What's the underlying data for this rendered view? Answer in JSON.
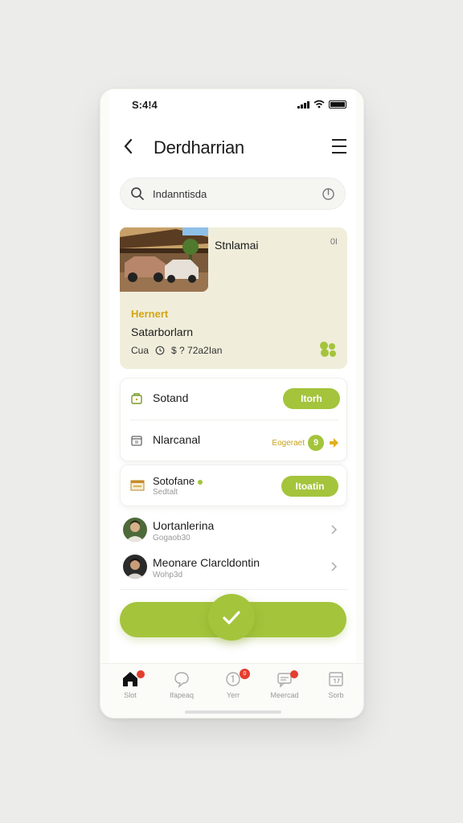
{
  "status_bar": {
    "time": "S:4!4"
  },
  "header": {
    "title": "Derdharrian"
  },
  "search": {
    "text": "Indanntisda"
  },
  "feature": {
    "title": "Stnlamai",
    "number": "0I",
    "tag": "Hernert",
    "subtitle": "Satarborlarn",
    "meta_left": "Cua",
    "meta_right": "$ ? 72a2Ian"
  },
  "list_card": {
    "row1": {
      "label": "Sotand",
      "button": "Itorh"
    },
    "row2": {
      "label": "Nlarcanal",
      "status": "Eogeraet",
      "badge": "9"
    }
  },
  "row3": {
    "label": "Sotofane",
    "sublabel": "Sedtalt",
    "button": "Itoatin"
  },
  "people": [
    {
      "name": "Uortanlerina",
      "sub": "Gogaob30"
    },
    {
      "name": "Meonare Clarcldontin",
      "sub": "Wohp3d"
    }
  ],
  "tabbar": {
    "tabs": [
      {
        "label": "Slot",
        "icon": "home-icon"
      },
      {
        "label": "Ifapeaq",
        "icon": "chat-icon"
      },
      {
        "label": "Yerr",
        "icon": "notification-icon",
        "badge": "0"
      },
      {
        "label": "Meercad",
        "icon": "messages-icon"
      },
      {
        "label": "Sorb",
        "icon": "calendar-icon"
      }
    ]
  },
  "colors": {
    "accent": "#a4c43c",
    "tag": "#d4a514",
    "badge": "#e43d2f",
    "feature_bg": "#f0eedb"
  }
}
